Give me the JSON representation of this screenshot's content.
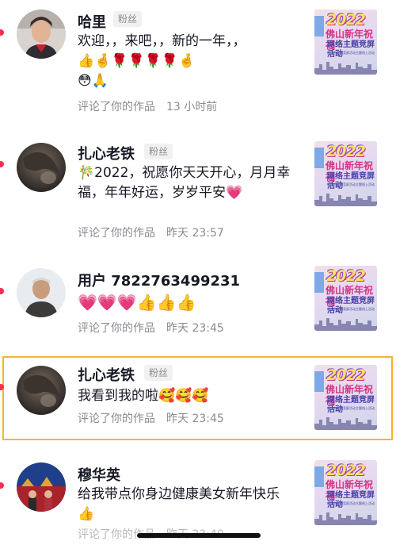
{
  "comments": [
    {
      "name": "哈里",
      "badge": "粉丝",
      "text": "欢迎，，来吧，，新的一年，，",
      "emojis_line1": "👍🤞🌹🌹🌹🌹🤞",
      "emojis_line2": "😳🙏",
      "action": "评论了你的作品",
      "time": "13 小时前",
      "thumb": {
        "year": "2022",
        "title": "佛山新年祝福",
        "subtitle": "网络主题竞屏活动",
        "tiny": "佛山市网络竞屏活动主题线上活动"
      }
    },
    {
      "name": "扎心老铁",
      "badge": "粉丝",
      "text_prefix": "🎋",
      "text": "2022，祝愿你天天开心，月月幸福，年年好运，岁岁平安",
      "emojis_line2": "💗",
      "action": "评论了你的作品",
      "time": "昨天 23:57",
      "thumb": {
        "year": "2022",
        "title": "佛山新年祝福",
        "subtitle": "网络主题竞屏活动",
        "tiny": "佛山市网络竞屏活动主题线上活动"
      }
    },
    {
      "name": "用户 7822763499231",
      "badge": "",
      "emojis_line1": "💗💗💗👍👍👍",
      "action": "评论了你的作品",
      "time": "昨天 23:45",
      "thumb": {
        "year": "2022",
        "title": "佛山新年祝福",
        "subtitle": "网络主题竞屏活动",
        "tiny": "佛山市网络竞屏活动主题线上活动"
      }
    },
    {
      "name": "扎心老铁",
      "badge": "粉丝",
      "text": "我看到我的啦",
      "emojis_line1": "🥰🥰🥰",
      "action": "评论了你的作品",
      "time": "昨天 23:45",
      "thumb": {
        "year": "2022",
        "title": "佛山新年祝福",
        "subtitle": "网络主题竞屏活动",
        "tiny": "佛山市网络竞屏活动主题线上活动"
      }
    },
    {
      "name": "穆华英",
      "badge": "",
      "text": "给我带点你身边健康美女新年快乐",
      "emojis_line2": "👍",
      "action": "评论了你的作品",
      "time": "昨天 23:40",
      "thumb": {
        "year": "2022",
        "title": "佛山新年祝福",
        "subtitle": "网络主题竞屏活动",
        "tiny": "佛山市网络竞屏活动主题线上活动"
      }
    }
  ],
  "colors": {
    "accent_dot": "#ff2d55",
    "highlight_border": "#f5b52b",
    "secondary_text": "#8a8b91"
  },
  "icons": {
    "unread": "red-dot",
    "home_indicator": "home-bar"
  }
}
